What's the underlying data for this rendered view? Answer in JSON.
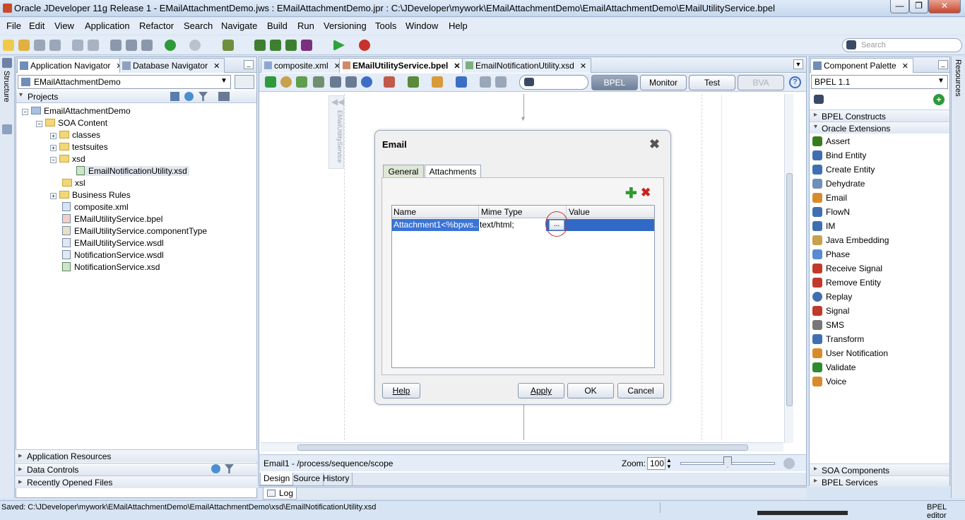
{
  "window": {
    "title": "Oracle JDeveloper 11g Release 1 - EMailAttachmentDemo.jws : EMailAttachmentDemo.jpr : C:\\JDeveloper\\mywork\\EMailAttachmentDemo\\EmailAttachmentDemo\\EMailUtilityService.bpel",
    "minimize": "—",
    "maximize": "❐",
    "close": "✕"
  },
  "menu": [
    "File",
    "Edit",
    "View",
    "Application",
    "Refactor",
    "Search",
    "Navigate",
    "Build",
    "Run",
    "Versioning",
    "Tools",
    "Window",
    "Help"
  ],
  "search": {
    "placeholder": "Search"
  },
  "side_left": {
    "structure": "Structure"
  },
  "side_right": {
    "resources": "Resources"
  },
  "navigator": {
    "tabs": [
      "Application Navigator",
      "Database Navigator"
    ],
    "app_select": "EMailAttachmentDemo",
    "projects_label": "Projects",
    "tree": [
      {
        "label": "EmailAttachmentDemo",
        "kind": "project",
        "exp": "−"
      },
      {
        "label": "SOA Content",
        "kind": "folder",
        "exp": "−"
      },
      {
        "label": "classes",
        "kind": "folder",
        "exp": "+"
      },
      {
        "label": "testsuites",
        "kind": "folder",
        "exp": "+"
      },
      {
        "label": "xsd",
        "kind": "folder",
        "exp": "−"
      },
      {
        "label": "EmailNotificationUtility.xsd",
        "kind": "file",
        "exp": ""
      },
      {
        "label": "xsl",
        "kind": "folder",
        "exp": ""
      },
      {
        "label": "Business Rules",
        "kind": "folder",
        "exp": "+"
      },
      {
        "label": "composite.xml",
        "kind": "file",
        "exp": ""
      },
      {
        "label": "EMailUtilityService.bpel",
        "kind": "file",
        "exp": ""
      },
      {
        "label": "EMailUtilityService.componentType",
        "kind": "file",
        "exp": ""
      },
      {
        "label": "EMailUtilityService.wsdl",
        "kind": "file",
        "exp": ""
      },
      {
        "label": "NotificationService.wsdl",
        "kind": "file",
        "exp": ""
      },
      {
        "label": "NotificationService.xsd",
        "kind": "file",
        "exp": ""
      }
    ],
    "sections": [
      "Application Resources",
      "Data Controls",
      "Recently Opened Files"
    ]
  },
  "editor": {
    "tabs": [
      "composite.xml",
      "EMailUtilityService.bpel",
      "EmailNotificationUtility.xsd"
    ],
    "modes": [
      "BPEL",
      "Monitor",
      "Test",
      "BVA"
    ],
    "vertical_label": "EMailUtilityService",
    "status_path": "Email1 - /process/sequence/scope",
    "zoom_label": "Zoom:",
    "zoom_value": "100",
    "bottom_tabs": [
      "Design",
      "Source",
      "History"
    ]
  },
  "dialog": {
    "title": "Email",
    "tabs": [
      "General",
      "Attachments"
    ],
    "columns": [
      "Name",
      "Mime Type",
      "Value"
    ],
    "row": {
      "name": "Attachment1<%bpws...",
      "mime": "text/html;",
      "value": "",
      "browse": "..."
    },
    "buttons": {
      "help": "Help",
      "apply": "Apply",
      "ok": "OK",
      "cancel": "Cancel"
    }
  },
  "palette": {
    "tab": "Component Palette",
    "select": "BPEL 1.1",
    "groups": [
      "BPEL Constructs",
      "Oracle Extensions"
    ],
    "items": [
      {
        "label": "Assert",
        "color": "#3a7a1e"
      },
      {
        "label": "Bind Entity",
        "color": "#3f6fb0"
      },
      {
        "label": "Create Entity",
        "color": "#3f6fb0"
      },
      {
        "label": "Dehydrate",
        "color": "#6f8fb8"
      },
      {
        "label": "Email",
        "color": "#d88b2a"
      },
      {
        "label": "FlowN",
        "color": "#3f6fb0"
      },
      {
        "label": "IM",
        "color": "#3f6fb0"
      },
      {
        "label": "Java Embedding",
        "color": "#c9a04b"
      },
      {
        "label": "Phase",
        "color": "#5a8ad0"
      },
      {
        "label": "Receive Signal",
        "color": "#c0392b"
      },
      {
        "label": "Remove Entity",
        "color": "#c0392b"
      },
      {
        "label": "Replay",
        "color": "#3f6fb0"
      },
      {
        "label": "Signal",
        "color": "#c0392b"
      },
      {
        "label": "SMS",
        "color": "#777777"
      },
      {
        "label": "Transform",
        "color": "#3f6fb0"
      },
      {
        "label": "User Notification",
        "color": "#d88b2a"
      },
      {
        "label": "Validate",
        "color": "#2e8b2e"
      },
      {
        "label": "Voice",
        "color": "#d88b2a"
      }
    ],
    "bottom_groups": [
      "SOA Components",
      "BPEL Services"
    ]
  },
  "log_tab": "Log",
  "statusbar": {
    "left": "Saved: C:\\JDeveloper\\mywork\\EMailAttachmentDemo\\EmailAttachmentDemo\\xsd\\EmailNotificationUtility.xsd",
    "right": "BPEL editor"
  }
}
